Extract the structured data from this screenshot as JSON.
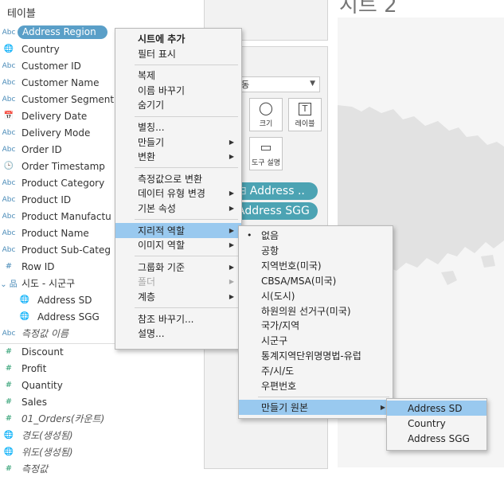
{
  "data_pane": {
    "title": "테이블",
    "fields": [
      {
        "icon": "Abc",
        "name": "Address Region",
        "type": "abc",
        "highlight": true
      },
      {
        "icon": "🌐",
        "name": "Country",
        "type": "geo"
      },
      {
        "icon": "Abc",
        "name": "Customer ID",
        "type": "abc"
      },
      {
        "icon": "Abc",
        "name": "Customer Name",
        "type": "abc"
      },
      {
        "icon": "Abc",
        "name": "Customer Segment",
        "type": "abc"
      },
      {
        "icon": "📅",
        "name": "Delivery Date",
        "type": "date"
      },
      {
        "icon": "Abc",
        "name": "Delivery Mode",
        "type": "abc"
      },
      {
        "icon": "Abc",
        "name": "Order ID",
        "type": "abc"
      },
      {
        "icon": "🕒",
        "name": "Order Timestamp",
        "type": "datetime"
      },
      {
        "icon": "Abc",
        "name": "Product Category",
        "type": "abc"
      },
      {
        "icon": "Abc",
        "name": "Product ID",
        "type": "abc"
      },
      {
        "icon": "Abc",
        "name": "Product Manufactu",
        "type": "abc"
      },
      {
        "icon": "Abc",
        "name": "Product Name",
        "type": "abc"
      },
      {
        "icon": "Abc",
        "name": "Product Sub-Categ",
        "type": "abc"
      },
      {
        "icon": "#",
        "name": "Row ID",
        "type": "num"
      },
      {
        "icon": "⌄ 品",
        "name": "시도 - 시군구",
        "type": "hier"
      },
      {
        "icon": "🌐",
        "name": "Address SD",
        "type": "geo",
        "nested": true
      },
      {
        "icon": "🌐",
        "name": "Address SGG",
        "type": "geo",
        "nested": true
      },
      {
        "icon": "Abc",
        "name": "측정값 이름",
        "type": "abc",
        "italic": true
      },
      {
        "icon": "#",
        "name": "Discount",
        "type": "measure"
      },
      {
        "icon": "#",
        "name": "Profit",
        "type": "measure"
      },
      {
        "icon": "#",
        "name": "Quantity",
        "type": "measure"
      },
      {
        "icon": "#",
        "name": "Sales",
        "type": "measure"
      },
      {
        "icon": "#",
        "name": "01_Orders(카운트)",
        "type": "measure",
        "italic": true
      },
      {
        "icon": "🌐",
        "name": "경도(생성됨)",
        "type": "measure-geo",
        "italic": true
      },
      {
        "icon": "🌐",
        "name": "위도(생성됨)",
        "type": "measure-geo",
        "italic": true
      },
      {
        "icon": "#",
        "name": "측정값",
        "type": "measure",
        "italic": true
      }
    ]
  },
  "marks": {
    "mark_type": "동",
    "buttons": [
      {
        "label": "크기",
        "glyph": "◯"
      },
      {
        "label": "레이블",
        "glyph": "T"
      },
      {
        "label": "도구 설명",
        "glyph": "▭"
      }
    ],
    "pills": [
      "Address ..",
      "Address SGG"
    ]
  },
  "canvas": {
    "title": "시트 2"
  },
  "context_menu": {
    "items": [
      {
        "label": "시트에 추가",
        "bold": true
      },
      {
        "label": "필터 표시"
      },
      {
        "sep": true
      },
      {
        "label": "복제"
      },
      {
        "label": "이름 바꾸기"
      },
      {
        "label": "숨기기"
      },
      {
        "sep": true
      },
      {
        "label": "별칭..."
      },
      {
        "label": "만들기",
        "submenu": true
      },
      {
        "label": "변환",
        "submenu": true
      },
      {
        "sep": true
      },
      {
        "label": "측정값으로 변환"
      },
      {
        "label": "데이터 유형 변경",
        "submenu": true
      },
      {
        "label": "기본 속성",
        "submenu": true
      },
      {
        "sep": true
      },
      {
        "label": "지리적 역할",
        "submenu": true,
        "active": true
      },
      {
        "label": "이미지 역할",
        "submenu": true
      },
      {
        "sep": true
      },
      {
        "label": "그룹화 기준",
        "submenu": true
      },
      {
        "label": "폴더",
        "submenu": true,
        "disabled": true
      },
      {
        "label": "계층",
        "submenu": true
      },
      {
        "sep": true
      },
      {
        "label": "참조 바꾸기..."
      },
      {
        "label": "설명..."
      }
    ]
  },
  "geo_role_menu": {
    "items": [
      {
        "label": "없음",
        "checked": true
      },
      {
        "label": "공항"
      },
      {
        "label": "지역번호(미국)"
      },
      {
        "label": "CBSA/MSA(미국)"
      },
      {
        "label": "시(도시)"
      },
      {
        "label": "하원의원 선거구(미국)"
      },
      {
        "label": "국가/지역"
      },
      {
        "label": "시군구"
      },
      {
        "label": "통계지역단위명명법-유럽"
      },
      {
        "label": "주/시/도"
      },
      {
        "label": "우편번호"
      },
      {
        "sep": true
      },
      {
        "label": "만들기 원본",
        "submenu": true,
        "active": true
      }
    ]
  },
  "create_from_menu": {
    "items": [
      {
        "label": "Address SD",
        "active": true
      },
      {
        "label": "Country"
      },
      {
        "label": "Address SGG"
      }
    ]
  }
}
